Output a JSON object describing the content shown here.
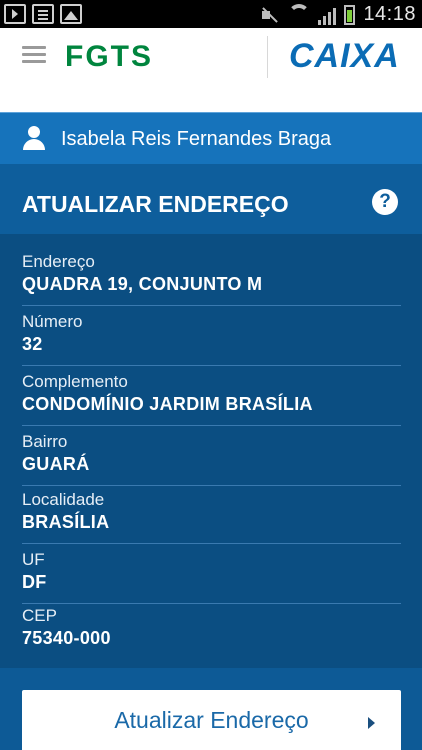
{
  "statusbar": {
    "time": "14:18",
    "icons": [
      "download-icon",
      "document-icon",
      "image-icon",
      "mute-icon",
      "wifi-icon",
      "signal-icon",
      "battery-icon"
    ]
  },
  "header": {
    "logo_left": "FGTS",
    "logo_right": "CAIXA",
    "menu_icon": "hamburger-menu-icon"
  },
  "user": {
    "name": "Isabela Reis Fernandes Braga",
    "icon": "user-icon"
  },
  "page": {
    "title": "ATUALIZAR ENDEREÇO",
    "help_icon": "help-icon",
    "help_glyph": "?"
  },
  "fields": [
    {
      "label": "Endereço",
      "value": "QUADRA 19, CONJUNTO M"
    },
    {
      "label": "Número",
      "value": "32"
    },
    {
      "label": "Complemento",
      "value": "CONDOMÍNIO JARDIM BRASÍLIA"
    },
    {
      "label": "Bairro",
      "value": "GUARÁ"
    },
    {
      "label": "Localidade",
      "value": "BRASÍLIA"
    },
    {
      "label": "UF",
      "value": "DF"
    },
    {
      "label": "CEP",
      "value": "75340-000"
    }
  ],
  "action": {
    "label": "Atualizar Endereço",
    "icon": "chevron-right-icon"
  },
  "colors": {
    "primary": "#0d5a96",
    "user_bar": "#1673bb",
    "field_panel": "#0b4e82",
    "fgts_green": "#00853e",
    "caixa_blue": "#0b6cb5",
    "caixa_orange": "#f39c12"
  }
}
